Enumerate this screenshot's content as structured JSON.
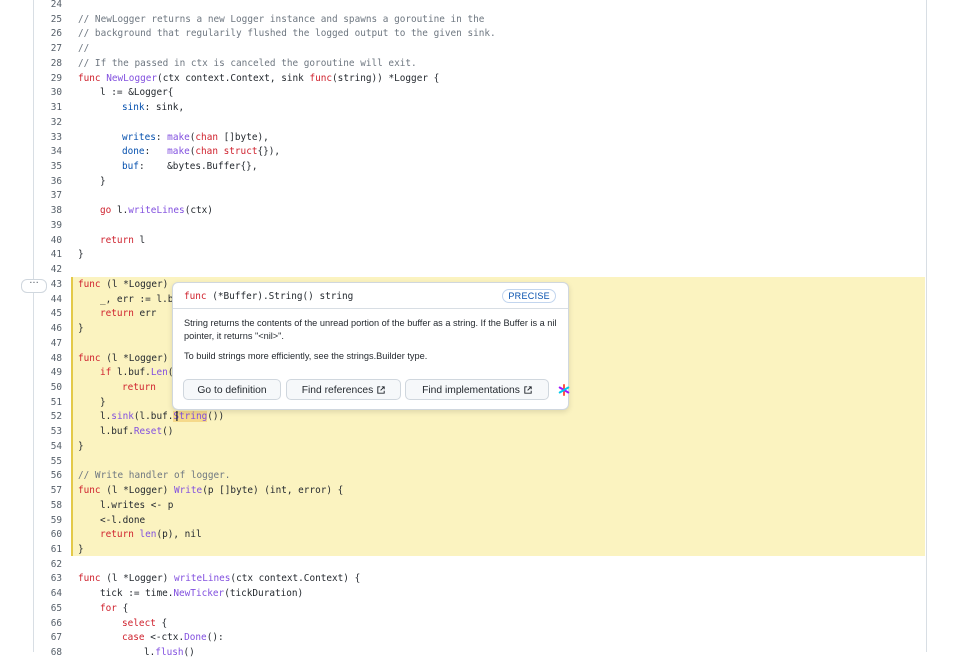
{
  "lines": [
    {
      "n": "24",
      "indent": 0,
      "parts": []
    },
    {
      "n": "25",
      "indent": 0,
      "parts": [
        {
          "t": "// NewLogger returns a new Logger instance and spawns a goroutine in the",
          "c": "com"
        }
      ]
    },
    {
      "n": "26",
      "indent": 0,
      "parts": [
        {
          "t": "// background that regularily flushed the logged output to the given sink.",
          "c": "com"
        }
      ]
    },
    {
      "n": "27",
      "indent": 0,
      "parts": [
        {
          "t": "//",
          "c": "com"
        }
      ]
    },
    {
      "n": "28",
      "indent": 0,
      "parts": [
        {
          "t": "// If the passed in ctx is canceled the goroutine will exit.",
          "c": "com"
        }
      ]
    },
    {
      "n": "29",
      "indent": 0,
      "parts": [
        {
          "t": "func ",
          "c": "kw"
        },
        {
          "t": "NewLogger",
          "c": "fn"
        },
        {
          "t": "(ctx context.Context, sink ",
          "c": ""
        },
        {
          "t": "func",
          "c": "kw"
        },
        {
          "t": "(string)) *Logger {",
          "c": ""
        }
      ]
    },
    {
      "n": "30",
      "indent": 1,
      "parts": [
        {
          "t": "l := &Logger{",
          "c": ""
        }
      ]
    },
    {
      "n": "31",
      "indent": 2,
      "parts": [
        {
          "t": "sink",
          "c": "ty"
        },
        {
          "t": ": sink,",
          "c": ""
        }
      ]
    },
    {
      "n": "32",
      "indent": 0,
      "parts": []
    },
    {
      "n": "33",
      "indent": 2,
      "parts": [
        {
          "t": "writes",
          "c": "ty"
        },
        {
          "t": ": ",
          "c": ""
        },
        {
          "t": "make",
          "c": "fn"
        },
        {
          "t": "(",
          "c": ""
        },
        {
          "t": "chan",
          "c": "kw"
        },
        {
          "t": " []byte),",
          "c": ""
        }
      ]
    },
    {
      "n": "34",
      "indent": 2,
      "parts": [
        {
          "t": "done",
          "c": "ty"
        },
        {
          "t": ":   ",
          "c": ""
        },
        {
          "t": "make",
          "c": "fn"
        },
        {
          "t": "(",
          "c": ""
        },
        {
          "t": "chan struct",
          "c": "kw"
        },
        {
          "t": "{}),",
          "c": ""
        }
      ]
    },
    {
      "n": "35",
      "indent": 2,
      "parts": [
        {
          "t": "buf",
          "c": "ty"
        },
        {
          "t": ":    &bytes.Buffer{},",
          "c": ""
        }
      ]
    },
    {
      "n": "36",
      "indent": 1,
      "parts": [
        {
          "t": "}",
          "c": ""
        }
      ]
    },
    {
      "n": "37",
      "indent": 0,
      "parts": []
    },
    {
      "n": "38",
      "indent": 1,
      "parts": [
        {
          "t": "go ",
          "c": "kw"
        },
        {
          "t": "l.",
          "c": ""
        },
        {
          "t": "writeLines",
          "c": "fn"
        },
        {
          "t": "(ctx)",
          "c": ""
        }
      ]
    },
    {
      "n": "39",
      "indent": 0,
      "parts": []
    },
    {
      "n": "40",
      "indent": 1,
      "parts": [
        {
          "t": "return ",
          "c": "kw"
        },
        {
          "t": "l",
          "c": ""
        }
      ]
    },
    {
      "n": "41",
      "indent": 0,
      "parts": [
        {
          "t": "}",
          "c": ""
        }
      ]
    },
    {
      "n": "42",
      "indent": 0,
      "parts": []
    },
    {
      "n": "43",
      "indent": 0,
      "parts": [
        {
          "t": "func ",
          "c": "kw"
        },
        {
          "t": "(l *Logger) ",
          "c": ""
        }
      ]
    },
    {
      "n": "44",
      "indent": 1,
      "parts": [
        {
          "t": "_, err := l.b",
          "c": ""
        }
      ]
    },
    {
      "n": "45",
      "indent": 1,
      "parts": [
        {
          "t": "return ",
          "c": "kw"
        },
        {
          "t": "err",
          "c": ""
        }
      ]
    },
    {
      "n": "46",
      "indent": 0,
      "parts": [
        {
          "t": "}",
          "c": ""
        }
      ]
    },
    {
      "n": "47",
      "indent": 0,
      "parts": []
    },
    {
      "n": "48",
      "indent": 0,
      "parts": [
        {
          "t": "func ",
          "c": "kw"
        },
        {
          "t": "(l *Logger)",
          "c": ""
        }
      ]
    },
    {
      "n": "49",
      "indent": 1,
      "parts": [
        {
          "t": "if ",
          "c": "kw"
        },
        {
          "t": "l.buf.",
          "c": ""
        },
        {
          "t": "Len",
          "c": "fn"
        },
        {
          "t": "(",
          "c": ""
        }
      ]
    },
    {
      "n": "50",
      "indent": 2,
      "parts": [
        {
          "t": "return",
          "c": "kw"
        }
      ]
    },
    {
      "n": "51",
      "indent": 1,
      "parts": [
        {
          "t": "}",
          "c": ""
        }
      ]
    },
    {
      "n": "52",
      "indent": 1,
      "parts": [
        {
          "t": "l.",
          "c": ""
        },
        {
          "t": "sink",
          "c": "fn"
        },
        {
          "t": "(l.buf.",
          "c": ""
        },
        {
          "t": "String",
          "c": "fn hlw"
        },
        {
          "t": "())",
          "c": ""
        }
      ]
    },
    {
      "n": "53",
      "indent": 1,
      "parts": [
        {
          "t": "l.buf.",
          "c": ""
        },
        {
          "t": "Reset",
          "c": "fn"
        },
        {
          "t": "()",
          "c": ""
        }
      ]
    },
    {
      "n": "54",
      "indent": 0,
      "parts": [
        {
          "t": "}",
          "c": ""
        }
      ]
    },
    {
      "n": "55",
      "indent": 0,
      "parts": []
    },
    {
      "n": "56",
      "indent": 0,
      "parts": [
        {
          "t": "// Write handler of logger.",
          "c": "com"
        }
      ]
    },
    {
      "n": "57",
      "indent": 0,
      "parts": [
        {
          "t": "func ",
          "c": "kw"
        },
        {
          "t": "(l *Logger) ",
          "c": ""
        },
        {
          "t": "Write",
          "c": "fn"
        },
        {
          "t": "(p []byte) (int, error) {",
          "c": ""
        }
      ]
    },
    {
      "n": "58",
      "indent": 1,
      "parts": [
        {
          "t": "l.writes <- p",
          "c": ""
        }
      ]
    },
    {
      "n": "59",
      "indent": 1,
      "parts": [
        {
          "t": "<-l.done",
          "c": ""
        }
      ]
    },
    {
      "n": "60",
      "indent": 1,
      "parts": [
        {
          "t": "return ",
          "c": "kw"
        },
        {
          "t": "len",
          "c": "fn"
        },
        {
          "t": "(p), nil",
          "c": ""
        }
      ]
    },
    {
      "n": "61",
      "indent": 0,
      "parts": [
        {
          "t": "}",
          "c": ""
        }
      ]
    },
    {
      "n": "62",
      "indent": 0,
      "parts": []
    },
    {
      "n": "63",
      "indent": 0,
      "parts": [
        {
          "t": "func ",
          "c": "kw"
        },
        {
          "t": "(l *Logger) ",
          "c": ""
        },
        {
          "t": "writeLines",
          "c": "fn"
        },
        {
          "t": "(ctx context.Context) {",
          "c": ""
        }
      ]
    },
    {
      "n": "64",
      "indent": 1,
      "parts": [
        {
          "t": "tick := time.",
          "c": ""
        },
        {
          "t": "NewTicker",
          "c": "fn"
        },
        {
          "t": "(tickDuration)",
          "c": ""
        }
      ]
    },
    {
      "n": "65",
      "indent": 1,
      "parts": [
        {
          "t": "for ",
          "c": "kw"
        },
        {
          "t": "{",
          "c": ""
        }
      ]
    },
    {
      "n": "66",
      "indent": 2,
      "parts": [
        {
          "t": "select ",
          "c": "kw"
        },
        {
          "t": "{",
          "c": ""
        }
      ]
    },
    {
      "n": "67",
      "indent": 2,
      "parts": [
        {
          "t": "case ",
          "c": "kw"
        },
        {
          "t": "<-ctx.",
          "c": ""
        },
        {
          "t": "Done",
          "c": "fn"
        },
        {
          "t": "():",
          "c": ""
        }
      ]
    },
    {
      "n": "68",
      "indent": 3,
      "parts": [
        {
          "t": "l.",
          "c": ""
        },
        {
          "t": "flush",
          "c": "fn"
        },
        {
          "t": "()",
          "c": ""
        }
      ]
    }
  ],
  "gutter": {
    "expand_label": "···"
  },
  "hover": {
    "signature_kw": "func",
    "signature_rest": " (*Buffer).String() string",
    "badge": "PRECISE",
    "description_1": "String returns the contents of the unread portion of the buffer as a string. If the Buffer is a nil pointer, it returns \"<nil>\".",
    "description_2": "To build strings more efficiently, see the strings.Builder type.",
    "actions": {
      "go_to_definition": "Go to definition",
      "find_references": "Find references",
      "find_implementations": "Find implementations"
    }
  },
  "icons": {
    "external": "external-link-icon",
    "brand": "sourcegraph-logo-icon"
  },
  "colors": {
    "highlight": "#fbf3c0",
    "keyword": "#cf222e",
    "function": "#8250df",
    "comment": "#6e7781",
    "field": "#0550ae"
  }
}
